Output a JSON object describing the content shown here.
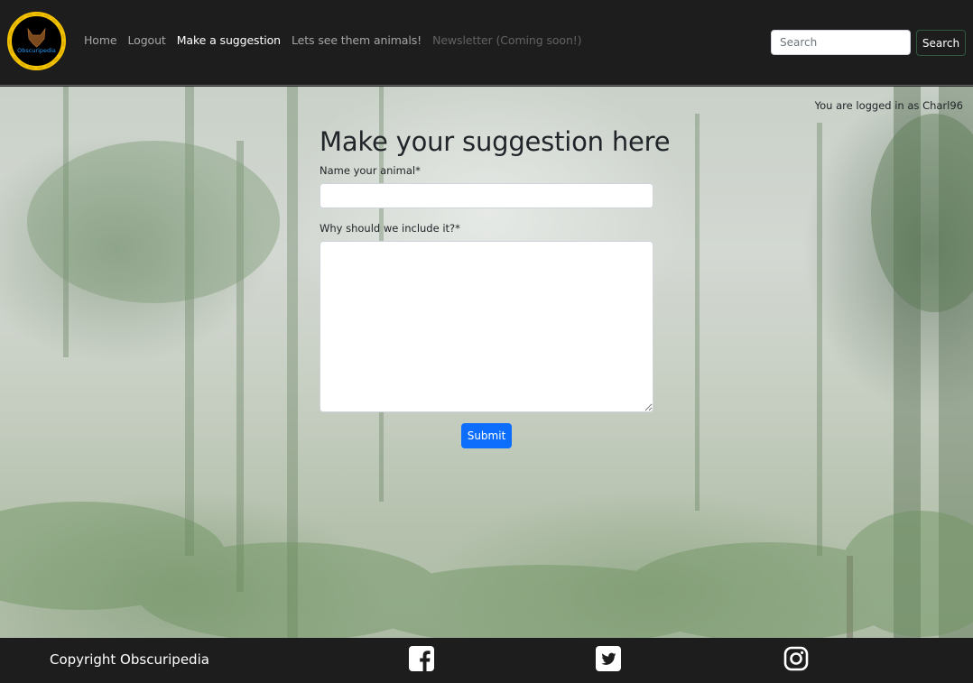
{
  "brand": {
    "logo_text": "Obscuripedia",
    "logo_ring_color": "#f2c200",
    "logo_text_color": "#2196f3"
  },
  "nav": {
    "items": [
      {
        "label": "Home",
        "state": "normal"
      },
      {
        "label": "Logout",
        "state": "normal"
      },
      {
        "label": "Make a suggestion",
        "state": "active"
      },
      {
        "label": "Lets see them animals!",
        "state": "normal"
      },
      {
        "label": "Newsletter (Coming soon!)",
        "state": "disabled"
      }
    ]
  },
  "search": {
    "placeholder": "Search",
    "value": "",
    "button_label": "Search"
  },
  "status": {
    "logged_in_text": "You are logged in as Charl96"
  },
  "form": {
    "title": "Make your suggestion here",
    "name_label": "Name your animal*",
    "name_value": "",
    "reason_label": "Why should we include it?*",
    "reason_value": "",
    "submit_label": "Submit",
    "submit_color": "#0d6efd"
  },
  "footer": {
    "copyright": "Copyright Obscuripedia",
    "social_icons": [
      "facebook-icon",
      "twitter-icon",
      "instagram-icon"
    ]
  }
}
